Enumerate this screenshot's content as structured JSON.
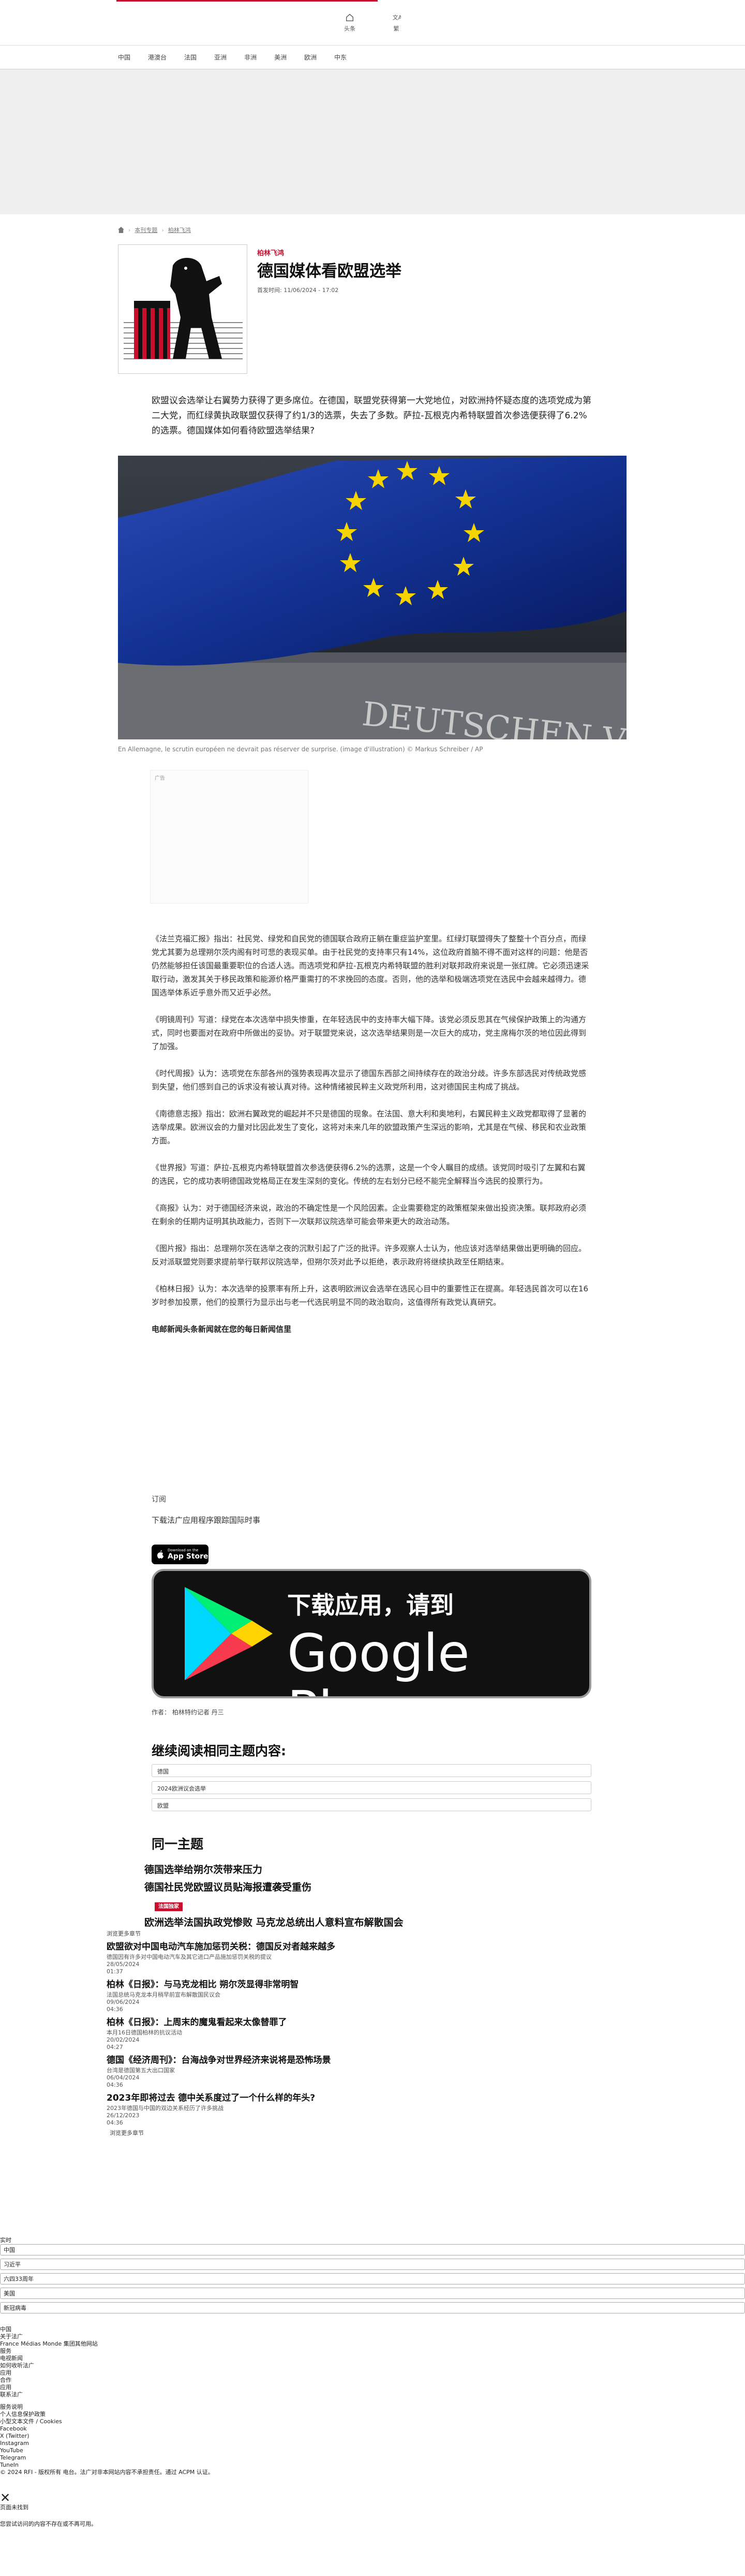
{
  "topbar": {
    "home": "头条",
    "translate": "繁"
  },
  "nav": [
    "中国",
    "港澳台",
    "法国",
    "亚洲",
    "非洲",
    "美洲",
    "欧洲",
    "中东"
  ],
  "breadcrumb": [
    "本刊专题",
    "柏林飞鸿"
  ],
  "article": {
    "kicker": "柏林飞鸿",
    "title": "德国媒体看欧盟选举",
    "date_label": "首发时间:",
    "date": "11/06/2024 - 17:02",
    "lead": "欧盟议会选举让右翼势力获得了更多席位。在德国，联盟党获得第一大党地位，对欧洲持怀疑态度的选项党成为第二大党，而红绿黄执政联盟仅获得了约1/3的选票，失去了多数。萨拉-瓦根克内希特联盟首次参选便获得了6.2%的选票。德国媒体如何看待欧盟选举结果?",
    "hero_text": "DEUTSCHEN VOLKE",
    "caption": "En Allemagne, le scrutin européen ne devrait pas réserver de surprise. (image d'illustration) © Markus Schreiber / AP",
    "ad_label": "广告",
    "paragraphs": [
      "《法兰克福汇报》指出：社民党、绿党和自民党的德国联合政府正躺在重症监护室里。红绿灯联盟得失了整整十个百分点，而绿党尤其要为总理朔尔茨内阁有时可悲的表现买单。由于社民党的支持率只有14%，这位政府首脑不得不面对这样的问题：他是否仍然能够担任该国最重要职位的合适人选。而选项党和萨拉-瓦根克内希特联盟的胜利对联邦政府来说是一张红牌。它必须迅速采取行动，激发其关于移民政策和能源价格严重需打的不求挽回的态度。否则，他的选举和极端选项党在选民中会越来越得力。德国选举体系近乎意外而又近乎必然。",
      "《明镜周刊》写道：绿党在本次选举中损失惨重，在年轻选民中的支持率大幅下降。该党必须反思其在气候保护政策上的沟通方式，同时也要面对在政府中所做出的妥协。对于联盟党来说，这次选举结果则是一次巨大的成功，党主席梅尔茨的地位因此得到了加强。",
      "《时代周报》认为：选项党在东部各州的强势表现再次显示了德国东西部之间持续存在的政治分歧。许多东部选民对传统政党感到失望，他们感到自己的诉求没有被认真对待。这种情绪被民粹主义政党所利用，这对德国民主构成了挑战。",
      "《南德意志报》指出：欧洲右翼政党的崛起并不只是德国的现象。在法国、意大利和奥地利，右翼民粹主义政党都取得了显著的选举成果。欧洲议会的力量对比因此发生了变化，这将对未来几年的欧盟政策产生深远的影响，尤其是在气候、移民和农业政策方面。",
      "《世界报》写道：萨拉-瓦根克内希特联盟首次参选便获得6.2%的选票，这是一个令人瞩目的成绩。该党同时吸引了左翼和右翼的选民，它的成功表明德国政党格局正在发生深刻的变化。传统的左右划分已经不能完全解释当今选民的投票行为。",
      "《商报》认为：对于德国经济来说，政治的不确定性是一个风险因素。企业需要稳定的政策框架来做出投资决策。联邦政府必须在剩余的任期内证明其执政能力，否则下一次联邦议院选举可能会带来更大的政治动荡。",
      "《图片报》指出：总理朔尔茨在选举之夜的沉默引起了广泛的批评。许多观察人士认为，他应该对选举结果做出更明确的回应。反对派联盟党则要求提前举行联邦议院选举，但朔尔茨对此予以拒绝，表示政府将继续执政至任期结束。",
      "《柏林日报》认为：本次选举的投票率有所上升，这表明欧洲议会选举在选民心目中的重要性正在提高。年轻选民首次可以在16岁时参加投票，他们的投票行为显示出与老一代选民明显不同的政治取向，这值得所有政党认真研究。"
    ],
    "paragraph_end": "电邮新闻头条新闻就在您的每日新闻信里",
    "subscribe": "订阅",
    "app_text": "下载法广应用程序跟踪国际时事",
    "appstore_small": "Download on the",
    "appstore_big": "App Store",
    "gplay_line1": "下载应用，请到",
    "gplay_line2": "Google Play",
    "author": "作者：   柏林特约记者 丹三"
  },
  "continue_title": "继续阅读相同主题内容:",
  "tags": [
    "德国",
    "2024欧洲议会选举",
    "欧盟"
  ],
  "same_title": "同一主题",
  "same_items": [
    "德国选举给朔尔茨带来压力",
    "德国社民党欧盟议员贴海报遭袭受重伤",
    "欧洲选举法国执政党惨败 马克龙总统出人意料宣布解散国会"
  ],
  "live_badge": "法国独家",
  "more": {
    "header": "浏览更多章节",
    "items": [
      {
        "title": "欧盟欲对中国电动汽车施加惩罚关税：德国反对者越来越多",
        "desc": "德国因有许多对中国电动汽车及其它进口产品施加惩罚关税的提议",
        "date": "28/05/2024",
        "time": "01:37"
      },
      {
        "title": "柏林《日报》：与马克龙相比 朔尔茨显得非常明智",
        "desc": "法国总统马克龙本月稍早前宣布解散国民议会",
        "date": "09/06/2024",
        "time": "04:36"
      },
      {
        "title": "柏林《日报》：上周末的魔鬼看起来太像替罪了",
        "desc": "本月16日德国柏林的抗议活动",
        "date": "20/02/2024",
        "time": "04:27"
      },
      {
        "title": "德国《经济周刊》：台海战争对世界经济来说将是恐怖场景",
        "desc": "台湾是德国第五大出口国家",
        "date": "06/04/2024",
        "time": "04:36"
      },
      {
        "title": "2023年即将过去 德中关系度过了一个什么样的年头?",
        "desc": "2023年德国与中国的双边关系经历了许多挑战",
        "date": "26/12/2023",
        "time": "04:36"
      }
    ],
    "all": "浏览更多章节"
  },
  "footer": {
    "live_label": "实时",
    "selects": [
      "中国",
      "习近平",
      "六四33周年",
      "美国",
      "新冠病毒"
    ],
    "links": [
      "中国",
      "关于法广",
      "France Médias Monde 集团其他网站",
      "服务",
      "电视新闻",
      "如何收听法广",
      "应用",
      "合作",
      "应用",
      "联系法广",
      "服务说明",
      "个人信息保护政策",
      "小型文本文件 / Cookies",
      "Facebook",
      "X (Twitter)",
      "Instagram",
      "YouTube",
      "Telegram",
      "TuneIn"
    ],
    "copyright": "© 2024 RFI - 版权所有 电台。法广对非本网站内容不承担责任。通过 ACPM 认证。",
    "close": "✕",
    "notfound_title": "页面未找到",
    "notfound_body": "您尝试访问的内容不存在或不再可用。"
  }
}
